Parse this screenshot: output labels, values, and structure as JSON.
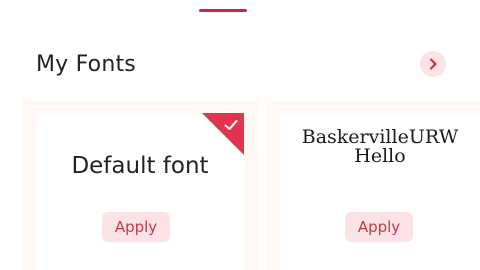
{
  "header": {
    "section_title": "My Fonts",
    "more_icon": "chevron-right-icon"
  },
  "fonts": [
    {
      "preview_text": "Default font",
      "apply_label": "Apply",
      "selected": true,
      "selected_icon": "check-icon"
    },
    {
      "name": "BaskervilleURW",
      "sample": "Hello",
      "apply_label": "Apply",
      "selected": false
    }
  ],
  "colors": {
    "accent": "#e3344f",
    "tab_indicator": "#c62844",
    "button_bg": "#fbe2e5",
    "button_text": "#c23a4b",
    "card_frame": "#fff8f4"
  }
}
